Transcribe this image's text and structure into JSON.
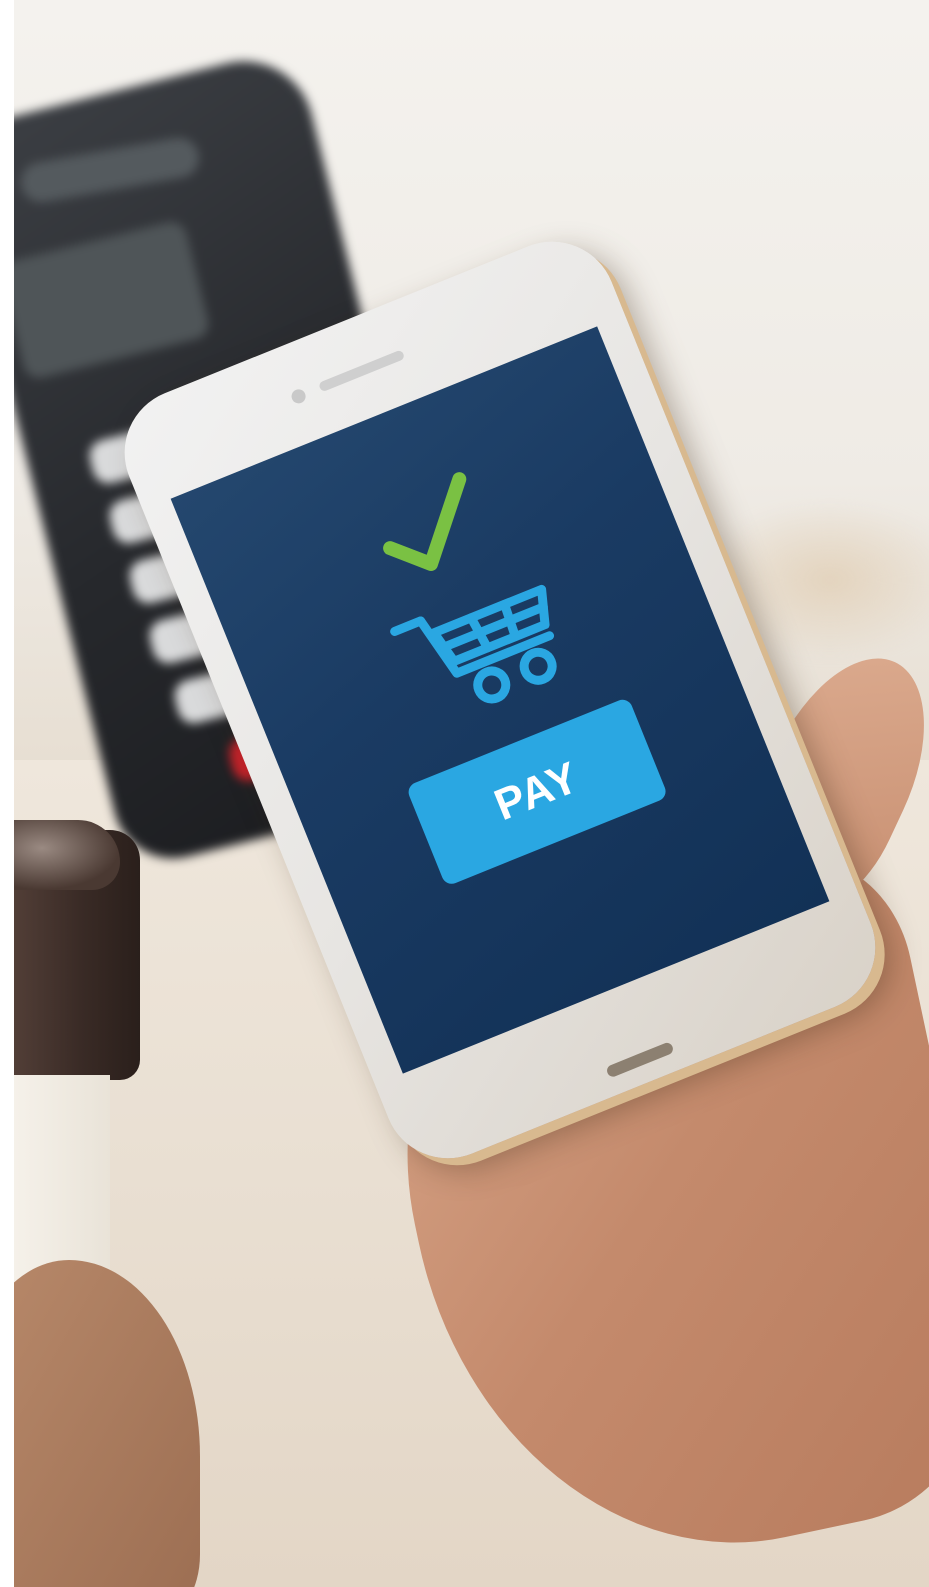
{
  "screen": {
    "pay_label": "PAY",
    "icons": [
      "checkmark-icon",
      "shopping-cart-icon"
    ],
    "colors": {
      "screen_background": "#1a3b63",
      "checkmark": "#7ac143",
      "cart": "#2aa7e2",
      "pay_button": "#2aa7e2"
    }
  }
}
